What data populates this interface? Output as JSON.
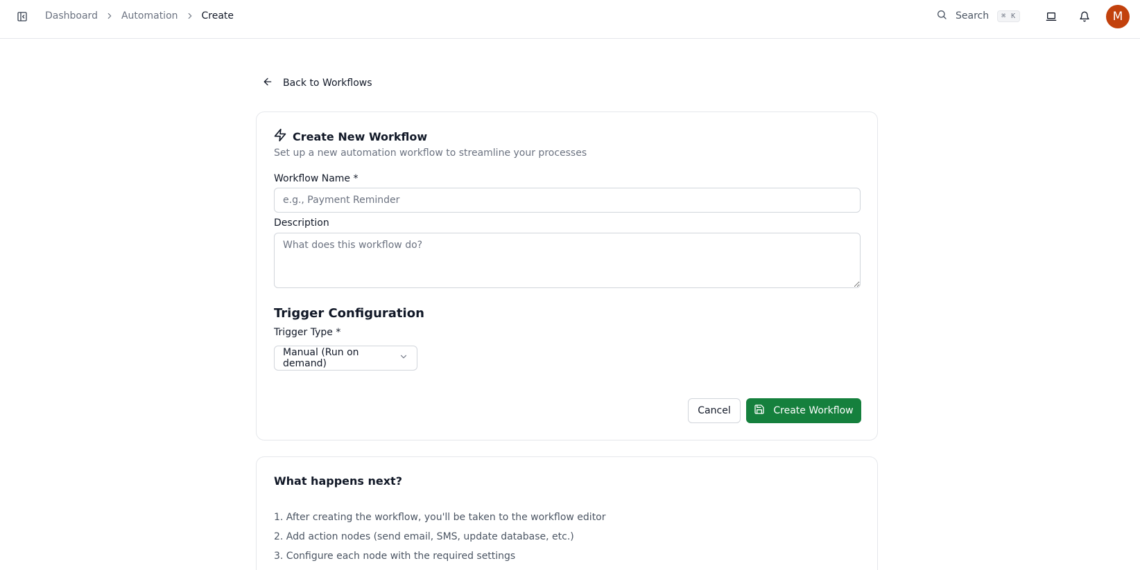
{
  "breadcrumb": {
    "items": [
      "Dashboard",
      "Automation"
    ],
    "current": "Create"
  },
  "header": {
    "search_label": "Search",
    "search_shortcut": "⌘ K",
    "avatar_initial": "M"
  },
  "back_link": {
    "label": "Back to Workflows"
  },
  "form": {
    "title": "Create New Workflow",
    "subtitle": "Set up a new automation workflow to streamline your processes",
    "name_label": "Workflow Name *",
    "name_placeholder": "e.g., Payment Reminder",
    "name_value": "",
    "description_label": "Description",
    "description_placeholder": "What does this workflow do?",
    "description_value": "",
    "trigger_section_title": "Trigger Configuration",
    "trigger_type_label": "Trigger Type *",
    "trigger_type_value": "Manual (Run on demand)",
    "cancel_label": "Cancel",
    "create_label": "Create Workflow"
  },
  "next_steps": {
    "title": "What happens next?",
    "items": [
      "1. After creating the workflow, you'll be taken to the workflow editor",
      "2. Add action nodes (send email, SMS, update database, etc.)",
      "3. Configure each node with the required settings"
    ]
  },
  "colors": {
    "primary": "#15803d",
    "avatar": "#c2410c",
    "border": "#e5e7eb",
    "muted_text": "#6b7280"
  },
  "icons": {
    "sidebar_toggle": "panel-left-icon",
    "breadcrumb_separator": "chevron-right-icon",
    "search": "search-icon",
    "laptop": "laptop-icon",
    "notifications": "bell-icon",
    "back": "arrow-left-icon",
    "title": "zap-icon",
    "select_caret": "chevron-down-icon",
    "save": "save-icon"
  }
}
